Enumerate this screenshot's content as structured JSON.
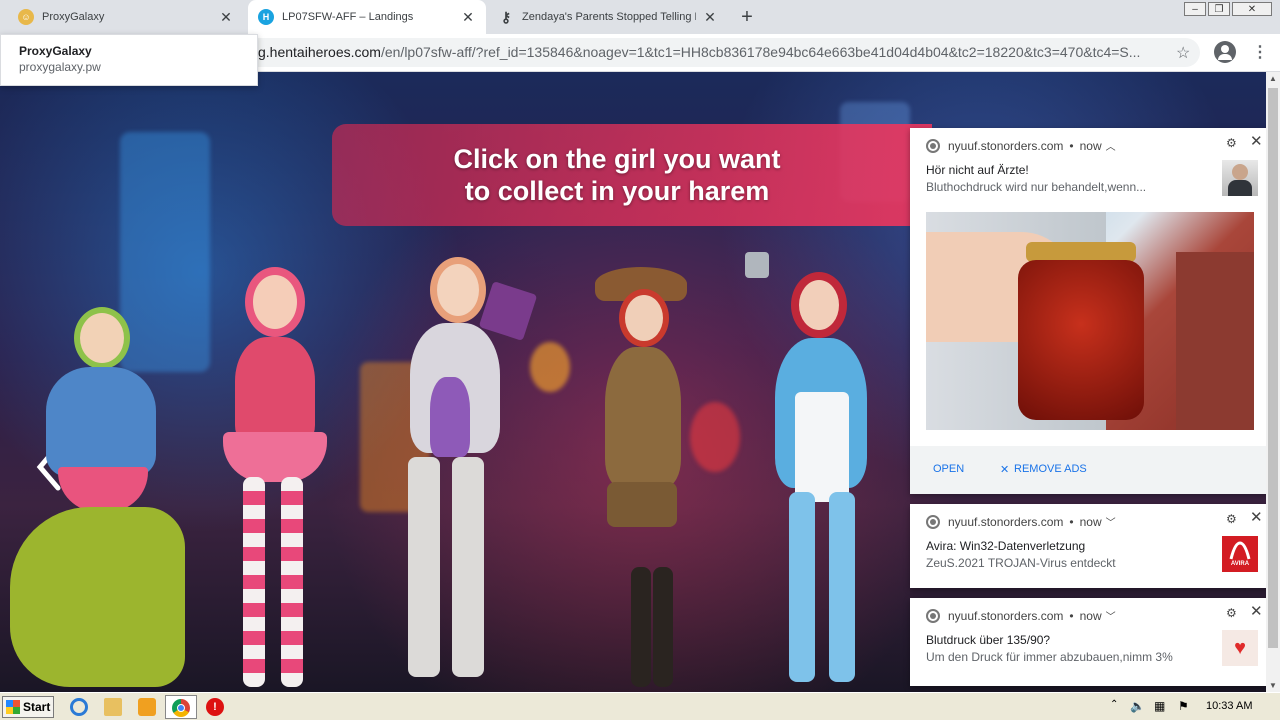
{
  "browser": {
    "tabs": [
      {
        "title": "ProxyGalaxy",
        "active": false
      },
      {
        "title": "LP07SFW-AFF – Landings",
        "active": true
      },
      {
        "title": "Zendaya's Parents Stopped Telling H",
        "active": false
      }
    ],
    "address": {
      "domain": "g.hentaiheroes.com",
      "path": "/en/lp07sfw-aff/?ref_id=135846&noagev=1&tc1=HH8cb836178e94bc64e663be41d04d4b04&tc2=18220&tc3=470&tc4=S..."
    },
    "tooltip": {
      "title": "ProxyGalaxy",
      "url": "proxygalaxy.pw"
    }
  },
  "page": {
    "banner": {
      "line1": "Click on the girl you want",
      "line2": "to collect in your harem"
    }
  },
  "notifications": [
    {
      "source": "nyuuf.stonorders.com",
      "time": "now",
      "title": "Hör nicht auf Ärzte!",
      "body": "Bluthochdruck wird nur behandelt,wenn...",
      "open_label": "OPEN",
      "remove_label": "REMOVE ADS"
    },
    {
      "source": "nyuuf.stonorders.com",
      "time": "now",
      "title": "Avira: Win32-Datenverletzung",
      "body": "ZeuS.2021 TROJAN-Virus entdeckt",
      "badge": "AVIRA"
    },
    {
      "source": "nyuuf.stonorders.com",
      "time": "now",
      "title": "Blutdruck über 135/90?",
      "body": "Um den Druck für immer abzubauen,nimm 3%"
    }
  ],
  "taskbar": {
    "start_label": "Start",
    "clock": "10:33 AM"
  },
  "colors": {
    "banner": "#e8375e",
    "link": "#1a73e8",
    "avira_red": "#d31c23"
  }
}
